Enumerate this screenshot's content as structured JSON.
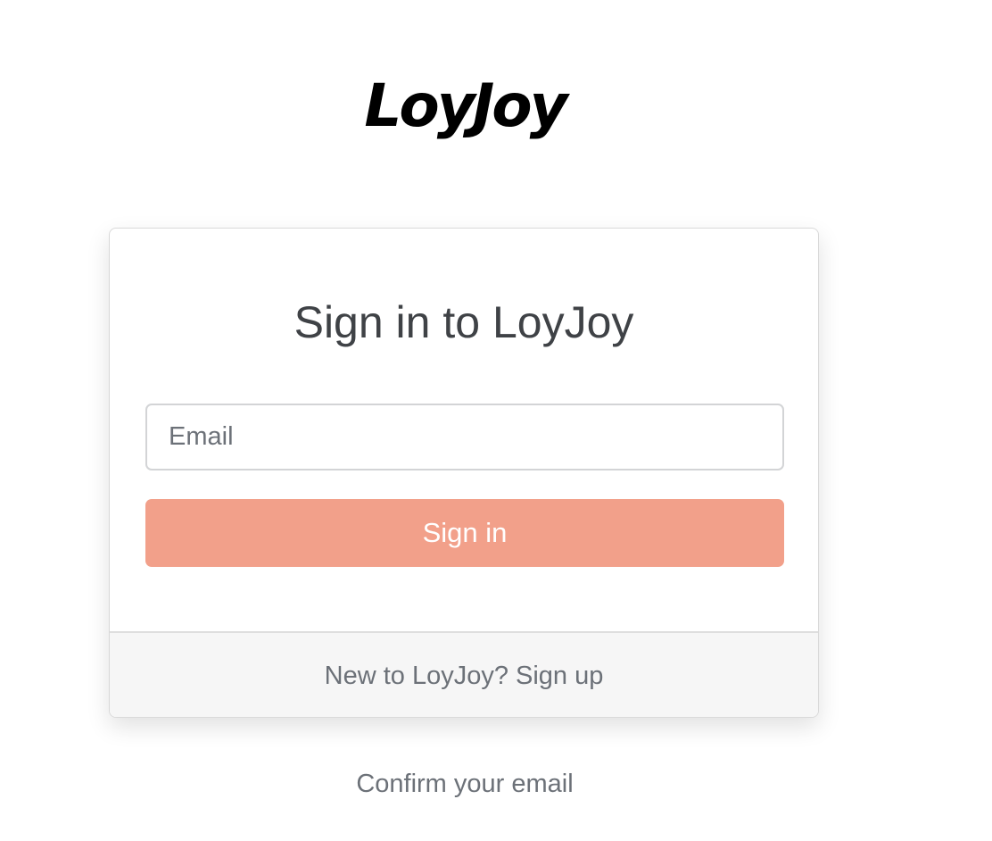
{
  "logo": {
    "text": "LoyJoy"
  },
  "card": {
    "title": "Sign in to LoyJoy",
    "email_input": {
      "value": "",
      "placeholder": "Email"
    },
    "signin_button_label": "Sign in",
    "footer": {
      "prompt_text": "New to LoyJoy?",
      "signup_link_label": "Sign up"
    }
  },
  "confirm_email_link": "Confirm your email",
  "colors": {
    "accent": "#f2a08a",
    "text_primary": "#3f4246",
    "text_muted": "#6c7178",
    "footer_bg": "#f6f6f6"
  }
}
